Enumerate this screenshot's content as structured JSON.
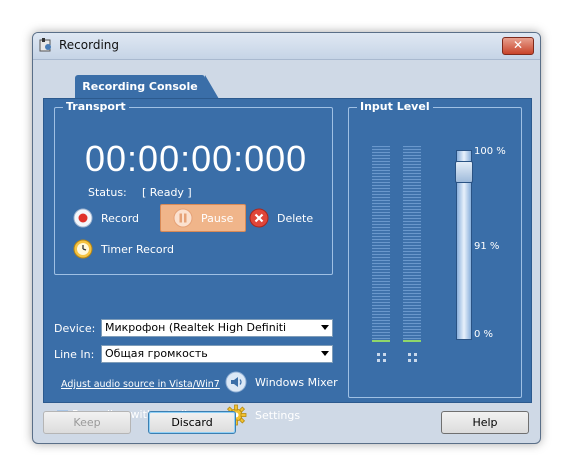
{
  "window": {
    "title": "Recording"
  },
  "tab": {
    "label": "Recording Console"
  },
  "transport": {
    "group_label": "Transport",
    "timer": "00:00:00:000",
    "status_label": "Status:",
    "status_value": "[ Ready ]",
    "record_label": "Record",
    "pause_label": "Pause",
    "delete_label": "Delete",
    "timer_record_label": "Timer Record"
  },
  "device": {
    "device_label": "Device:",
    "device_value": "Микрофон (Realtek High Definiti",
    "linein_label": "Line In:",
    "linein_value": "Общая громкость",
    "adjust_link": "Adjust audio source in Vista/Win7",
    "windows_mixer_label": "Windows Mixer",
    "silence_label": "Recording without silence",
    "settings_label": "Settings"
  },
  "input_level": {
    "group_label": "Input Level",
    "max_label": "100 %",
    "current_label": "91 %",
    "min_label": "0 %",
    "volume_fraction": 0.91
  },
  "footer": {
    "keep_label": "Keep",
    "discard_label": "Discard",
    "help_label": "Help"
  },
  "colors": {
    "panel": "#3a6ea8",
    "pause_highlight": "#f0b58a",
    "level_green": "#8fd66a"
  }
}
